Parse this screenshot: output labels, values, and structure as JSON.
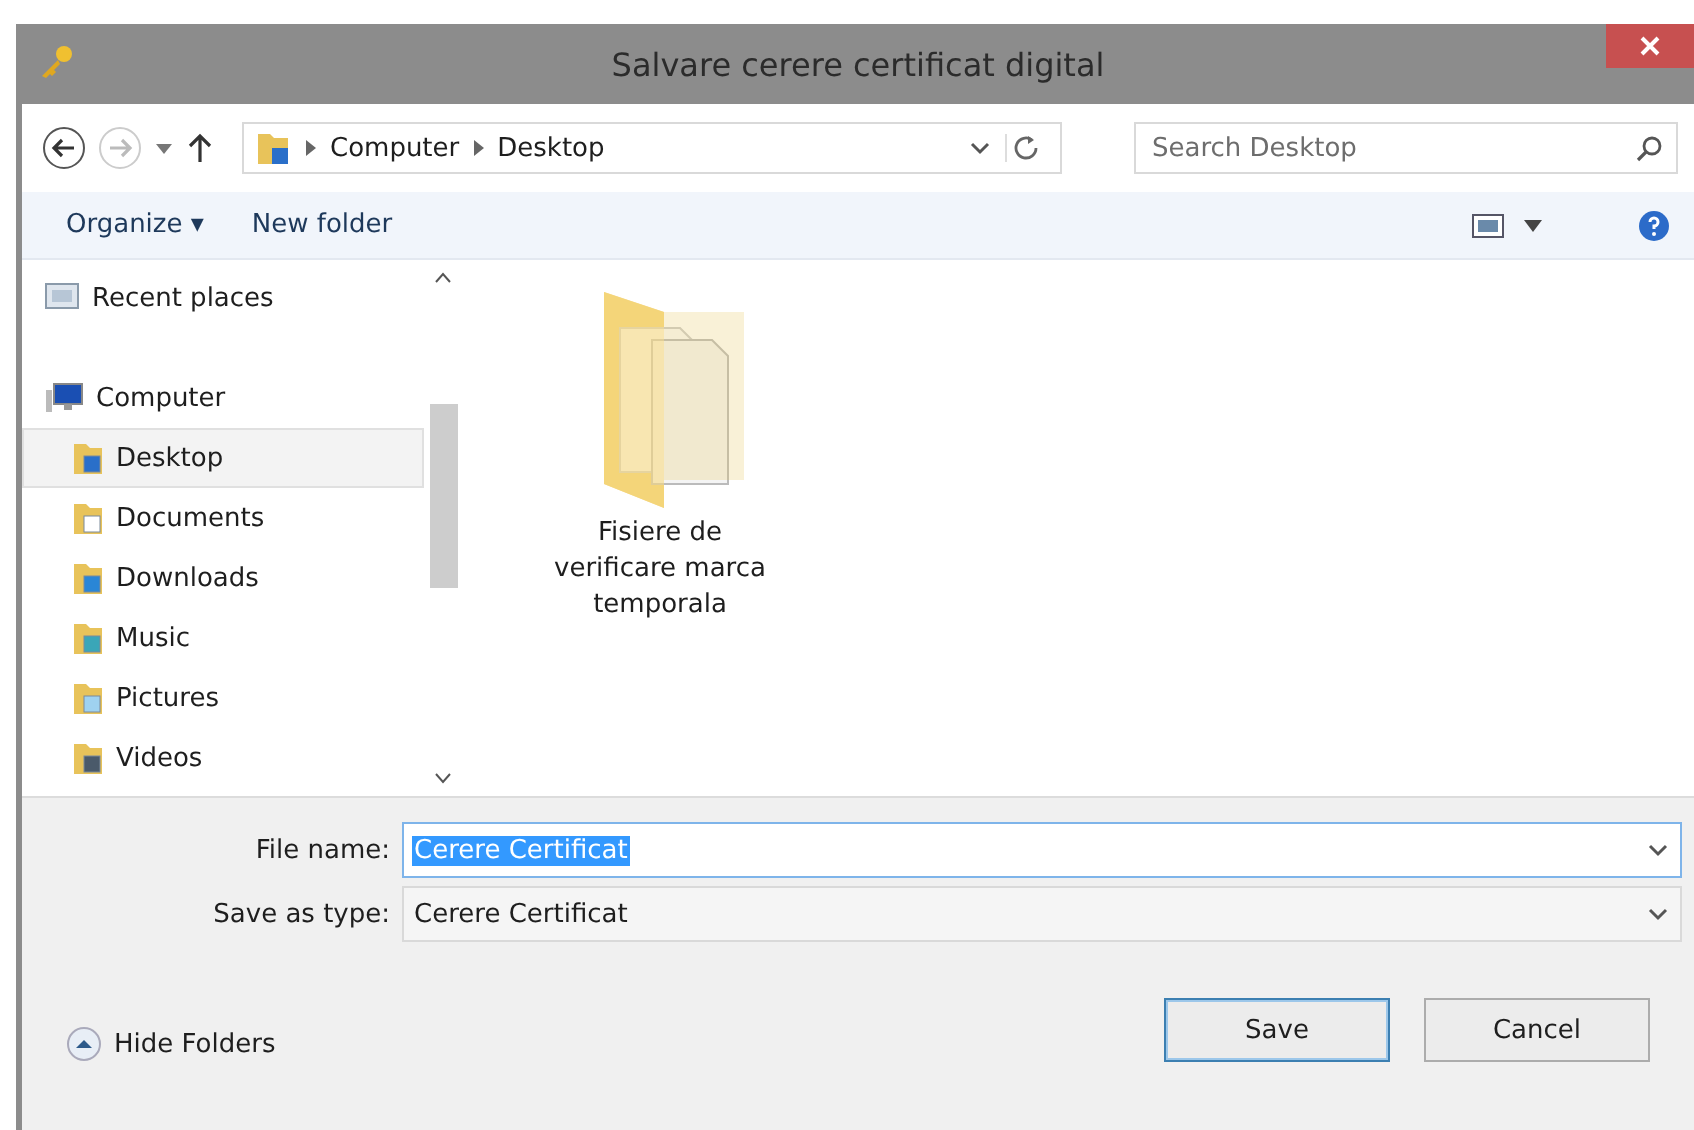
{
  "window": {
    "title": "Salvare cerere certificat digital"
  },
  "address": {
    "crumbs": [
      "Computer",
      "Desktop"
    ]
  },
  "search": {
    "placeholder": "Search Desktop"
  },
  "toolbar": {
    "organize": "Organize ▾",
    "new_folder": "New folder"
  },
  "sidebar": {
    "items": [
      {
        "label": "Recent places",
        "kind": "recent",
        "selected": false
      },
      {
        "label": "Computer",
        "kind": "computer",
        "selected": false,
        "children": [
          {
            "label": "Desktop",
            "kind": "desktop",
            "selected": true
          },
          {
            "label": "Documents",
            "kind": "documents",
            "selected": false
          },
          {
            "label": "Downloads",
            "kind": "downloads",
            "selected": false
          },
          {
            "label": "Music",
            "kind": "music",
            "selected": false
          },
          {
            "label": "Pictures",
            "kind": "pictures",
            "selected": false
          },
          {
            "label": "Videos",
            "kind": "videos",
            "selected": false
          }
        ]
      }
    ]
  },
  "files": [
    {
      "label": "Fisiere de verificare marca temporala",
      "kind": "folder"
    }
  ],
  "fields": [
    {
      "label": "File name:",
      "value": "Cerere Certificat",
      "kind": "editable"
    },
    {
      "label": "Save as type:",
      "value": "Cerere Certificat",
      "kind": "select"
    }
  ],
  "hide_folders": "Hide Folders",
  "buttons": [
    {
      "label": "Save",
      "default": true
    },
    {
      "label": "Cancel",
      "default": false
    }
  ]
}
